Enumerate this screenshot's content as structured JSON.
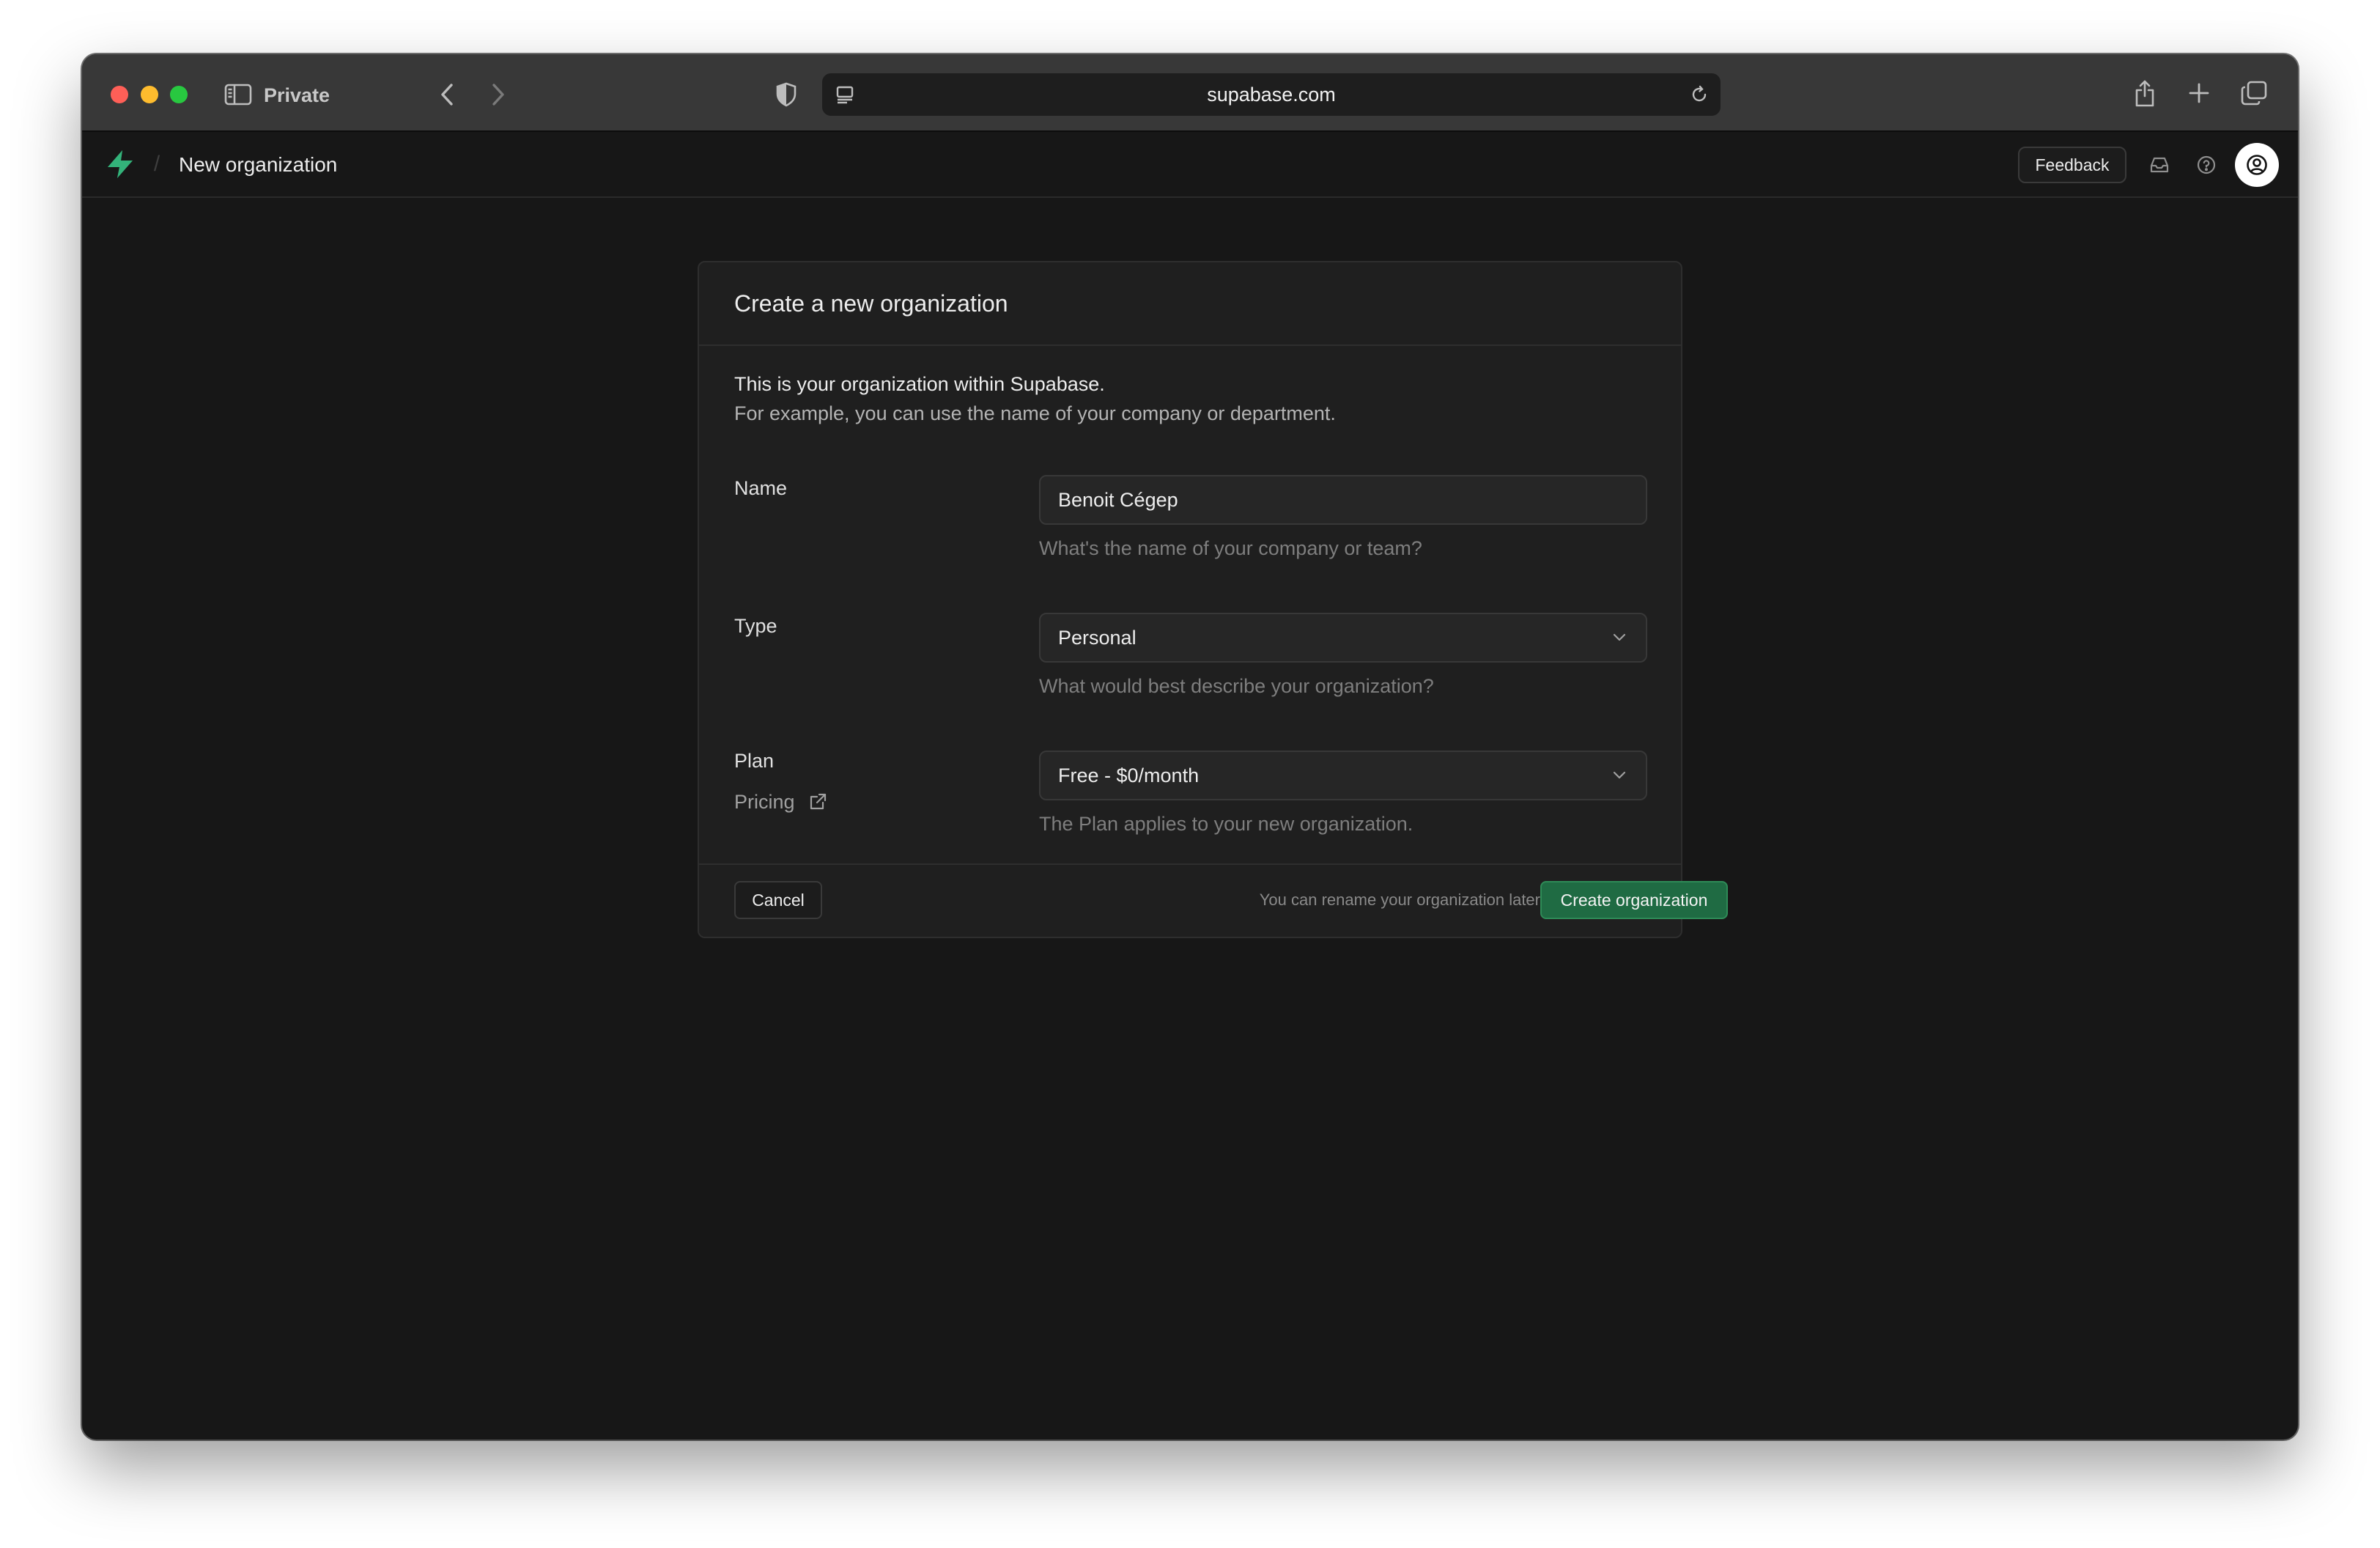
{
  "browser": {
    "window_label": "Private",
    "url": "supabase.com"
  },
  "header": {
    "breadcrumb_separator": "/",
    "breadcrumb": "New organization",
    "feedback_label": "Feedback"
  },
  "card": {
    "title": "Create a new organization",
    "intro_line1": "This is your organization within Supabase.",
    "intro_line2": "For example, you can use the name of your company or department.",
    "fields": {
      "name": {
        "label": "Name",
        "value": "Benoit Cégep",
        "help": "What's the name of your company or team?"
      },
      "type": {
        "label": "Type",
        "value": "Personal",
        "help": "What would best describe your organization?"
      },
      "plan": {
        "label": "Plan",
        "pricing_link": "Pricing",
        "value": "Free - $0/month",
        "help": "The Plan applies to your new organization."
      }
    },
    "footer": {
      "cancel_label": "Cancel",
      "note": "You can rename your organization later",
      "create_label": "Create organization"
    }
  },
  "colors": {
    "brand_green": "#3ecf8e",
    "primary_button": "#1f6b43",
    "background": "#171717",
    "card": "#1f1f1f"
  },
  "icons": {
    "sidebar": "sidebar-icon",
    "back": "chevron-left-icon",
    "forward": "chevron-right-icon",
    "privacy": "shield-icon",
    "page_menu": "page-menu-icon",
    "reload": "reload-icon",
    "share": "share-icon",
    "new_tab": "plus-icon",
    "tabs": "tabs-overview-icon",
    "logo": "supabase-logo-icon",
    "inbox": "inbox-icon",
    "help": "help-circle-icon",
    "avatar": "user-icon",
    "external": "external-link-icon",
    "select": "chevron-down-icon"
  }
}
